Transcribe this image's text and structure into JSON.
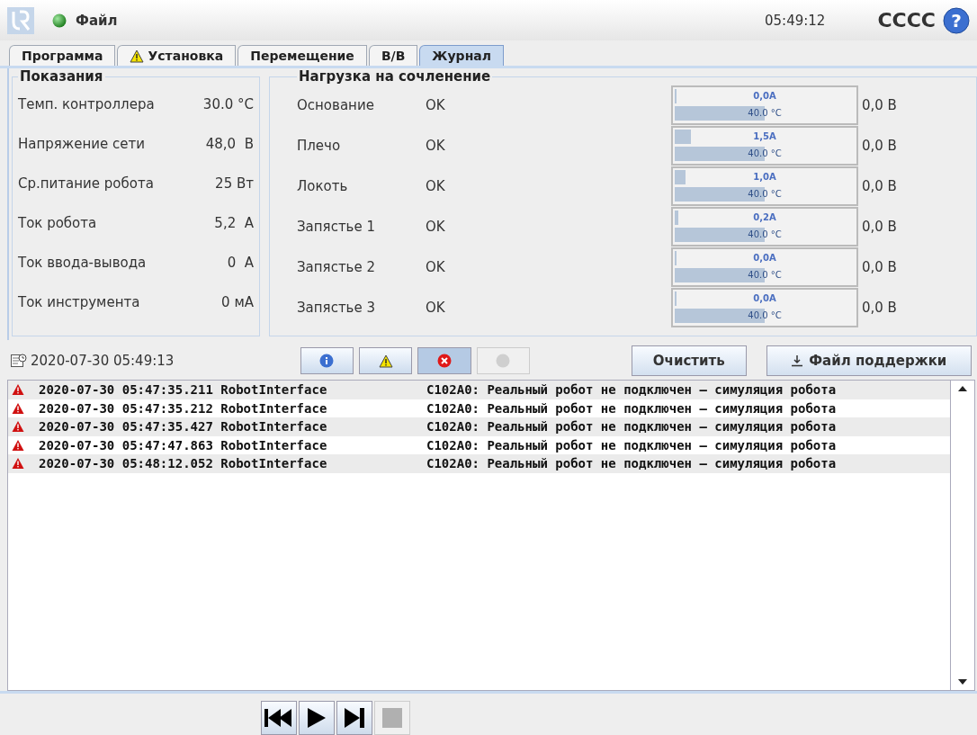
{
  "header": {
    "menu": "Файл",
    "time": "05:49:12",
    "robot_name": "CCCC",
    "help": "?"
  },
  "tabs": [
    {
      "label": "Программа",
      "selected": false,
      "warning": false
    },
    {
      "label": "Установка",
      "selected": false,
      "warning": true
    },
    {
      "label": "Перемещение",
      "selected": false,
      "warning": false
    },
    {
      "label": "В/В",
      "selected": false,
      "warning": false
    },
    {
      "label": "Журнал",
      "selected": true,
      "warning": false
    }
  ],
  "readings": {
    "title": "Показания",
    "rows": [
      {
        "label": "Темп. контроллера",
        "value": "30.0 °C"
      },
      {
        "label": "Напряжение сети",
        "value": "48,0  В"
      },
      {
        "label": "Ср.питание робота",
        "value": "25 Вт"
      },
      {
        "label": "Ток робота",
        "value": "5,2  А"
      },
      {
        "label": "Ток ввода-вывода",
        "value": "0  А"
      },
      {
        "label": "Ток инструмента",
        "value": "0 мА"
      }
    ]
  },
  "joint_load": {
    "title": "Нагрузка на сочленение",
    "joints": [
      {
        "name": "Основание",
        "status": "OK",
        "current": {
          "reading": "0,0A",
          "level": 0
        },
        "temperature": {
          "reading": "40.0 °C",
          "level": 0.5
        },
        "voltage": "0,0 В"
      },
      {
        "name": "Плечо",
        "status": "OK",
        "current": {
          "reading": "1,5A",
          "level": 0.09
        },
        "temperature": {
          "reading": "40.0 °C",
          "level": 0.5
        },
        "voltage": "0,0 В"
      },
      {
        "name": "Локоть",
        "status": "OK",
        "current": {
          "reading": "1,0A",
          "level": 0.06
        },
        "temperature": {
          "reading": "40.0 °C",
          "level": 0.5
        },
        "voltage": "0,0 В"
      },
      {
        "name": "Запястье 1",
        "status": "OK",
        "current": {
          "reading": "0,2A",
          "level": 0.02
        },
        "temperature": {
          "reading": "40.0 °C",
          "level": 0.5
        },
        "voltage": "0,0 В"
      },
      {
        "name": "Запястье 2",
        "status": "OK",
        "current": {
          "reading": "0,0A",
          "level": 0
        },
        "temperature": {
          "reading": "40.0 °C",
          "level": 0.5
        },
        "voltage": "0,0 В"
      },
      {
        "name": "Запястье 3",
        "status": "OK",
        "current": {
          "reading": "0,0A",
          "level": 0
        },
        "temperature": {
          "reading": "40.0 °C",
          "level": 0.5
        },
        "voltage": "0,0 В"
      }
    ]
  },
  "log_toolbar": {
    "timestamp": "2020-07-30 05:49:13",
    "filters": [
      {
        "kind": "info",
        "selected": false,
        "disabled": false
      },
      {
        "kind": "warning",
        "selected": false,
        "disabled": false
      },
      {
        "kind": "error",
        "selected": true,
        "disabled": false
      },
      {
        "kind": "other",
        "selected": false,
        "disabled": true
      }
    ],
    "buttons": [
      {
        "kind": "clear",
        "label": "Очистить"
      },
      {
        "kind": "download",
        "label": "Файл поддержки"
      }
    ]
  },
  "log": [
    {
      "kind": "error",
      "time": "2020-07-30 05:47:35.211",
      "source": "RobotInterface",
      "message": "C102A0: Реальный робот не подключен – симуляция робота"
    },
    {
      "kind": "error",
      "time": "2020-07-30 05:47:35.212",
      "source": "RobotInterface",
      "message": "C102A0: Реальный робот не подключен – симуляция робота"
    },
    {
      "kind": "error",
      "time": "2020-07-30 05:47:35.427",
      "source": "RobotInterface",
      "message": "C102A0: Реальный робот не подключен – симуляция робота"
    },
    {
      "kind": "error",
      "time": "2020-07-30 05:47:47.863",
      "source": "RobotInterface",
      "message": "C102A0: Реальный робот не подключен – симуляция робота"
    },
    {
      "kind": "error",
      "time": "2020-07-30 05:48:12.052",
      "source": "RobotInterface",
      "message": "C102A0: Реальный робот не подключен – симуляция робота"
    }
  ],
  "playback": [
    {
      "kind": "rewind",
      "disabled": false
    },
    {
      "kind": "play",
      "disabled": false
    },
    {
      "kind": "step",
      "disabled": false
    },
    {
      "kind": "stop",
      "disabled": true
    }
  ]
}
